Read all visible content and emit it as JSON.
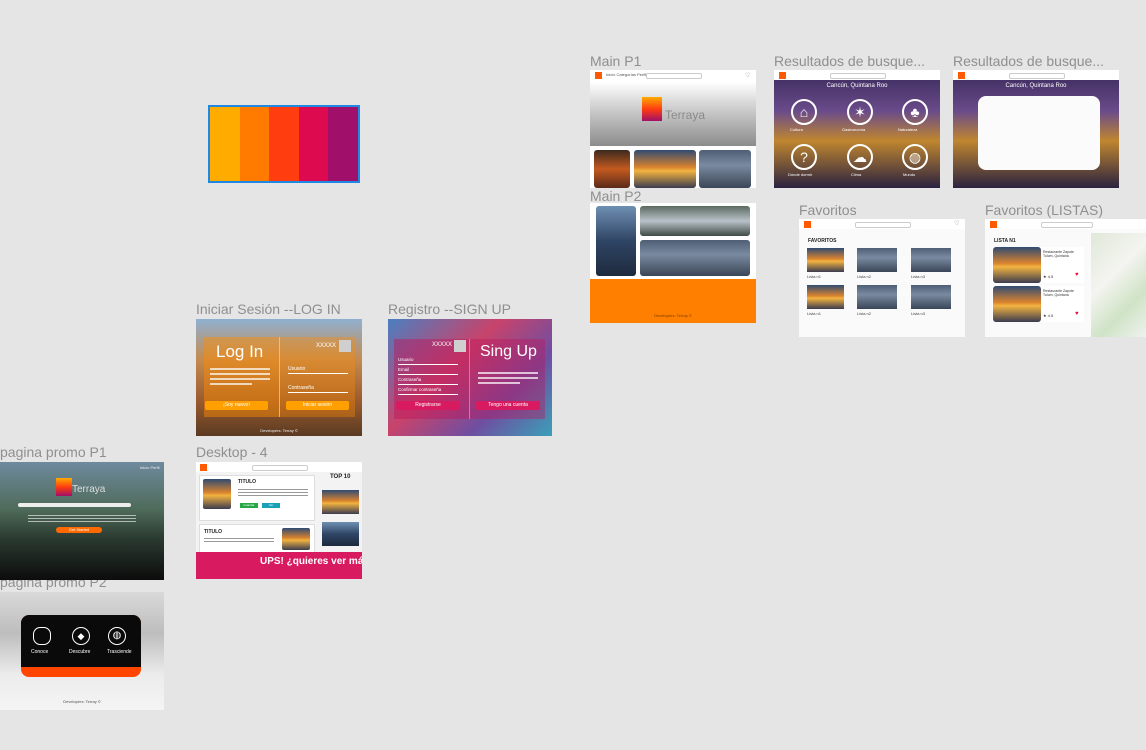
{
  "canvas": {
    "labels": {
      "main_p1": "Main P1",
      "resultados_1": "Resultados de busque...",
      "resultados_2": "Resultados de busque...",
      "main_p2": "Main P2",
      "favoritos": "Favoritos",
      "favoritos_listas": "Favoritos (LISTAS)",
      "iniciar_sesion": "Iniciar Sesión --LOG IN",
      "registro": "Registro --SIGN UP",
      "promo_p1": "pagina promo P1",
      "desktop4": "Desktop - 4",
      "promo_p2": "pagina promo P2"
    }
  },
  "palette": {
    "colors": [
      "#ffab00",
      "#ff7b00",
      "#ff3d0f",
      "#dd0a50",
      "#a0106a"
    ]
  },
  "main_p1": {
    "nav": "Inicio  Categorías  Perfil",
    "logo_word": "Terraya"
  },
  "resultados": {
    "location": "Cancún, Quintana Roo",
    "categories": [
      "Cultura",
      "Gastronomía",
      "Naturaleza",
      "Dónde dormir",
      "Clima",
      "Mundo"
    ]
  },
  "main_p2": {
    "footer": "Developers: Terray ©"
  },
  "favoritos": {
    "title": "FAVORITOS",
    "lists": [
      "Lista n1",
      "Lista n2",
      "Lista n3",
      "Lista n1",
      "Lista n2",
      "Lista n3"
    ]
  },
  "favoritos_listas": {
    "title": "LISTA N1",
    "items": [
      {
        "name": "Restaurante Zapote Tulum, Quintana",
        "rating": "4.5"
      },
      {
        "name": "Restaurante Zapote Tulum, Quintana",
        "rating": "4.5"
      }
    ]
  },
  "login": {
    "title": "Log In",
    "subtitle": "XXXXX",
    "fields": [
      "Usuario",
      "Contraseña"
    ],
    "left_button": "¡Soy nuevo!",
    "right_button": "Iniciar sesión",
    "footer": "Developers: Terray ©"
  },
  "signup": {
    "title": "Sing Up",
    "subtitle": "XXXXX",
    "fields": [
      "Usuario",
      "Email",
      "Contraseña",
      "Confirmar contraseña"
    ],
    "left_button": "Registrarse",
    "right_button": "Tengo una cuenta"
  },
  "desktop4": {
    "card1_title": "TITULO",
    "card2_title": "TITULO",
    "top10": "TOP 10",
    "banner": "UPS! ¿quieres ver más?",
    "button1": "Guardar",
    "button2": "Ver"
  },
  "promo_p1": {
    "logo_word": "Terraya",
    "nav": "Inicio  Perfil",
    "cta": "Get Started"
  },
  "promo_p2": {
    "features": [
      "Conoce",
      "Descubre",
      "Trasciende"
    ],
    "footer": "Developers: Terray ©"
  }
}
